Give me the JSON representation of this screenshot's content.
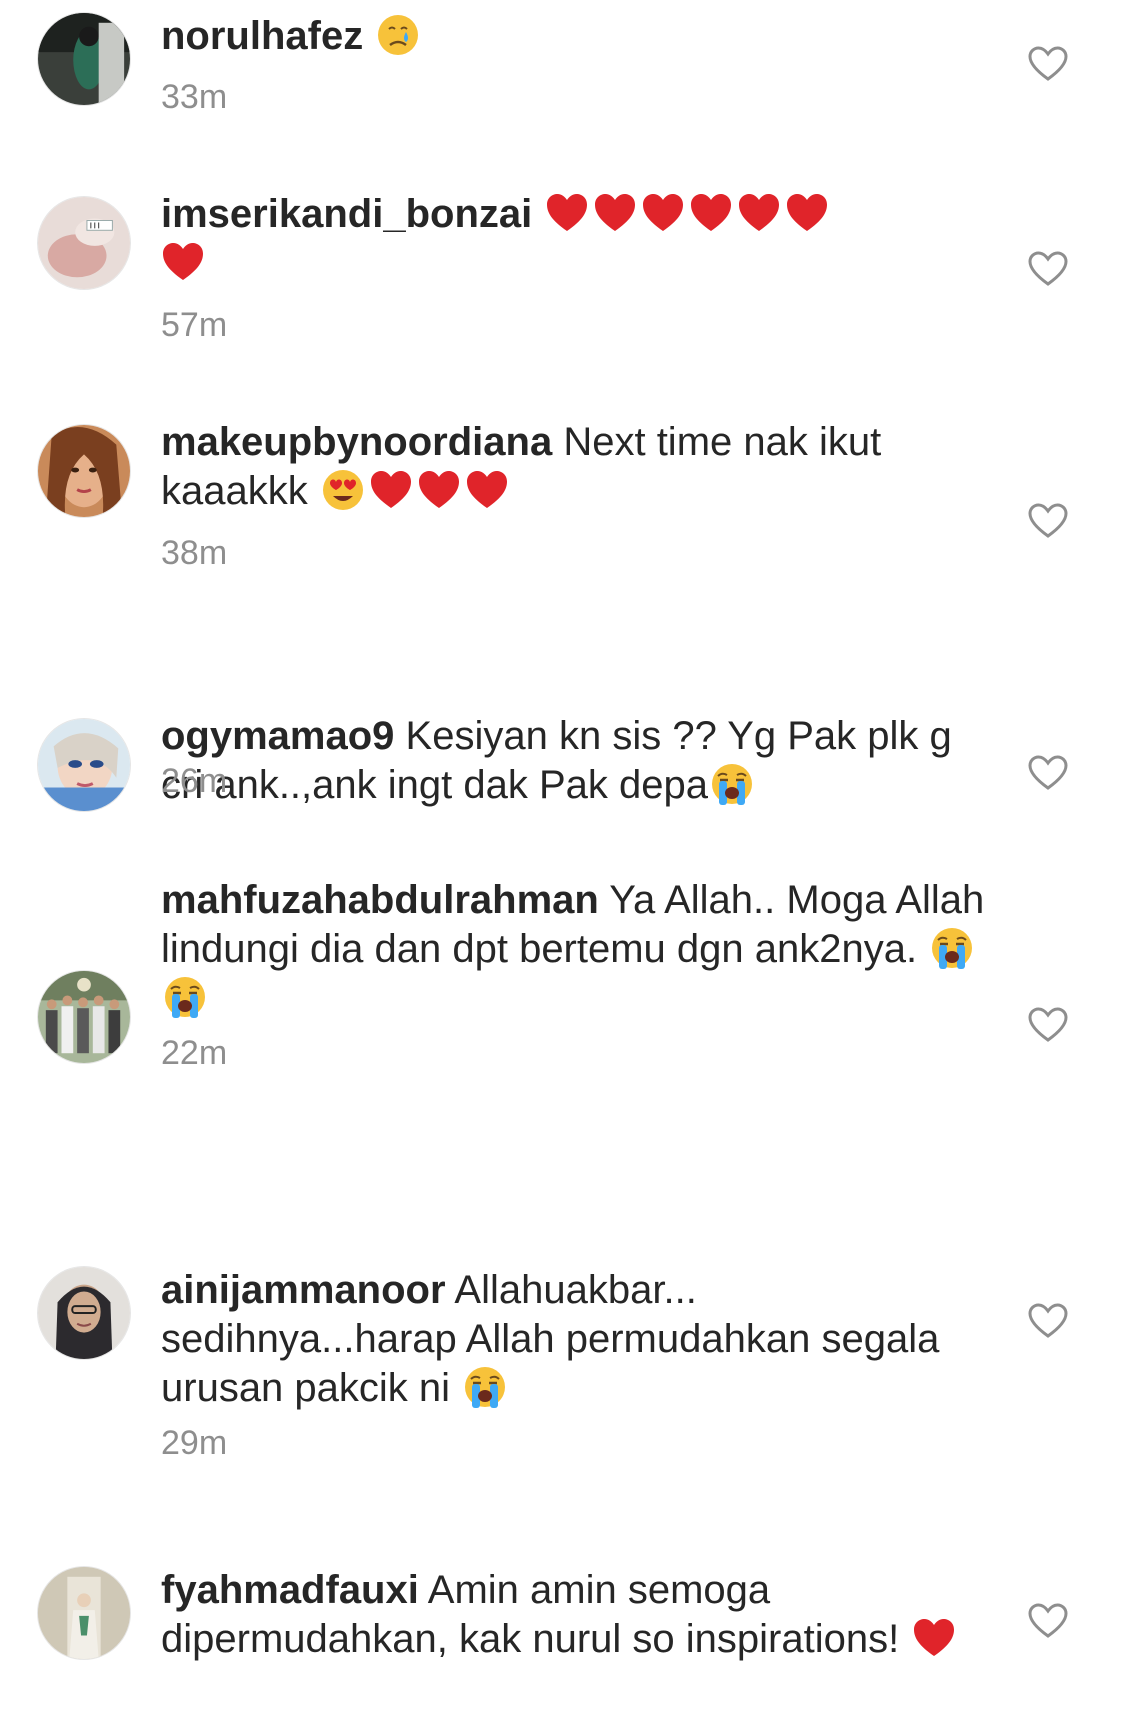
{
  "comments": [
    {
      "username": "norulhafez",
      "text": "",
      "emojis": [
        "crying-face"
      ],
      "time": "33m"
    },
    {
      "username": "imserikandi_bonzai",
      "text": "",
      "emojis": [
        "red-heart",
        "red-heart",
        "red-heart",
        "red-heart",
        "red-heart",
        "red-heart",
        "red-heart"
      ],
      "time": "57m"
    },
    {
      "username": "makeupbynoordiana",
      "text": "Next time nak ikut kaaakkk",
      "emojis": [
        "heart-eyes-face",
        "red-heart",
        "red-heart",
        "red-heart"
      ],
      "time": "38m"
    },
    {
      "username": "ogymamao9",
      "text": "Kesiyan kn sis ?? Yg Pak plk g cri ank..,ank ingt dak Pak depa",
      "emojis": [
        "loudly-crying-face"
      ],
      "time": "26m"
    },
    {
      "username": "mahfuzahabdulrahman",
      "text": "Ya Allah.. Moga Allah lindungi dia dan dpt bertemu dgn ank2nya.",
      "emojis": [
        "loudly-crying-face",
        "loudly-crying-face"
      ],
      "time": "22m"
    },
    {
      "username": "ainijammanoor",
      "text": "Allahuakbar... sedihnya...harap Allah permudahkan segala urusan pakcik ni",
      "emojis": [
        "loudly-crying-face"
      ],
      "time": "29m"
    },
    {
      "username": "fyahmadfauxi",
      "text": "Amin amin semoga dipermudahkan, kak nurul so inspirations!",
      "emojis": [
        "red-heart"
      ],
      "time": ""
    }
  ],
  "colors": {
    "text": "#262626",
    "secondary": "#8e8e8e",
    "heart_red": "#e0242a",
    "emoji_yellow": "#f7c23a",
    "tear_blue": "#3fa9f5"
  },
  "icons": {
    "like": "heart-outline-icon"
  }
}
